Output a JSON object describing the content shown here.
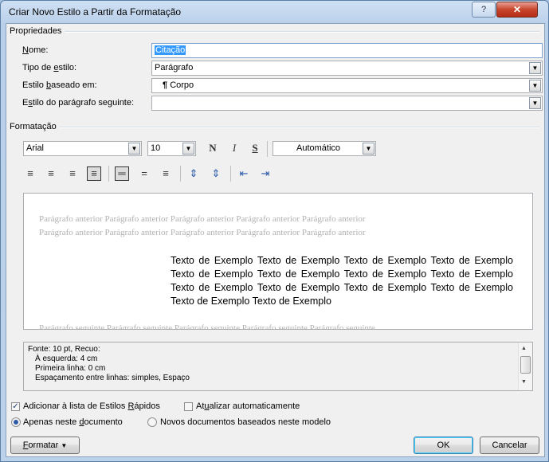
{
  "window": {
    "title": "Criar Novo Estilo a Partir da Formatação",
    "help_glyph": "?",
    "close_glyph": "✕"
  },
  "properties": {
    "group_title": "Propriedades",
    "name_label": "Nome:",
    "name_value": "Citação",
    "style_type_label": "Tipo de estilo:",
    "style_type_value": "Parágrafo",
    "based_on_label": "Estilo baseado em:",
    "based_on_value": "Corpo",
    "based_on_glyph": "¶",
    "next_style_label": "Estilo do parágrafo seguinte:",
    "next_style_value": ""
  },
  "formatting": {
    "group_title": "Formatação",
    "font_name": "Arial",
    "font_size": "10",
    "bold": "N",
    "italic": "I",
    "underline": "S",
    "color": "Automático"
  },
  "preview": {
    "previous_line1": "Parágrafo anterior Parágrafo anterior Parágrafo anterior Parágrafo anterior Parágrafo anterior",
    "previous_line2": "Parágrafo anterior Parágrafo anterior Parágrafo anterior Parágrafo anterior Parágrafo anterior",
    "sample_text": "Texto de Exemplo Texto de Exemplo Texto de Exemplo Texto de Exemplo Texto de Exemplo Texto de Exemplo Texto de Exemplo Texto de Exemplo Texto de Exemplo Texto de Exemplo Texto de Exemplo Texto de Exemplo Texto de Exemplo Texto de Exemplo",
    "following_line": "Parágrafo seguinte Parágrafo seguinte Parágrafo seguinte Parágrafo seguinte Parágrafo seguinte"
  },
  "description": {
    "line1": "Fonte: 10 pt, Recuo:",
    "line2": "À esquerda:  4 cm",
    "line3": "Primeira linha:  0 cm",
    "line4": "Espaçamento entre linhas:  simples, Espaço"
  },
  "options": {
    "add_quick_styles": "Adicionar à lista de Estilos Rápidos",
    "add_quick_styles_checked": true,
    "auto_update": "Atualizar automaticamente",
    "auto_update_checked": false,
    "only_this_doc": "Apenas neste documento",
    "new_docs_template": "Novos documentos baseados neste modelo",
    "selected_scope": "only_this_doc"
  },
  "buttons": {
    "format": "Formatar",
    "ok": "OK",
    "cancel": "Cancelar"
  }
}
